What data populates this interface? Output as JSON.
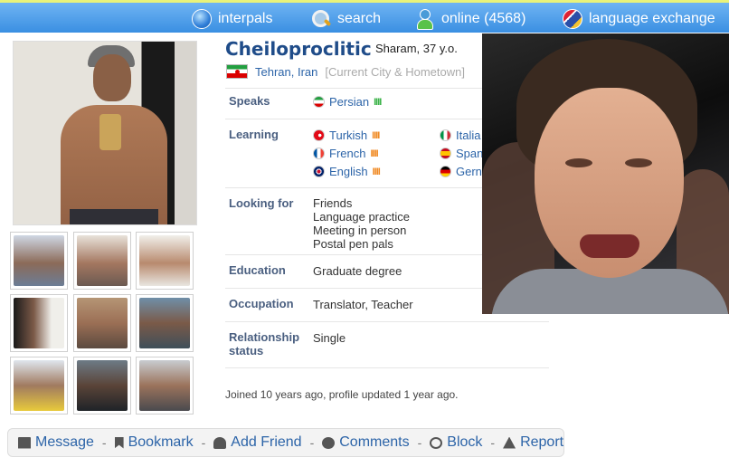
{
  "nav": {
    "site": "interpals",
    "search": "search",
    "online": "online (4568)",
    "exchange": "language exchange"
  },
  "profile": {
    "username": "Cheiloproclitic",
    "meta": "Sharam, 37 y.o.",
    "city": "Tehran, Iran",
    "city_hint": "[Current City & Hometown]",
    "photo_count": 9
  },
  "rows": {
    "speaks_label": "Speaks",
    "learning_label": "Learning",
    "looking_label": "Looking for",
    "education_label": "Education",
    "occupation_label": "Occupation",
    "relationship_label": "Relationship status",
    "education": "Graduate degree",
    "occupation": "Translator, Teacher",
    "relationship": "Single"
  },
  "speaks": [
    {
      "name": "Persian",
      "level_marks": "IIII",
      "level_color": "#3db34a"
    }
  ],
  "learning": [
    {
      "name": "Turkish",
      "level_marks": "IIII"
    },
    {
      "name": "French",
      "level_marks": "IIII"
    },
    {
      "name": "English",
      "level_marks": "IIII"
    },
    {
      "name": "Italia"
    },
    {
      "name": "Span"
    },
    {
      "name": "Gern"
    }
  ],
  "looking_for": [
    "Friends",
    "Language practice",
    "Meeting in person",
    "Postal pen pals"
  ],
  "footer_note": "Joined 10 years ago, profile updated 1 year ago.",
  "actions": {
    "message": "Message",
    "bookmark": "Bookmark",
    "add_friend": "Add Friend",
    "comments": "Comments",
    "block": "Block",
    "report": "Report",
    "separator": "-"
  },
  "colors": {
    "accent_link": "#2c64a8",
    "title": "#1f4c89",
    "label": "#4a5f80",
    "nav_bar": "#3a8fe2",
    "level_green": "#3db34a",
    "level_orange": "#f08a24"
  }
}
